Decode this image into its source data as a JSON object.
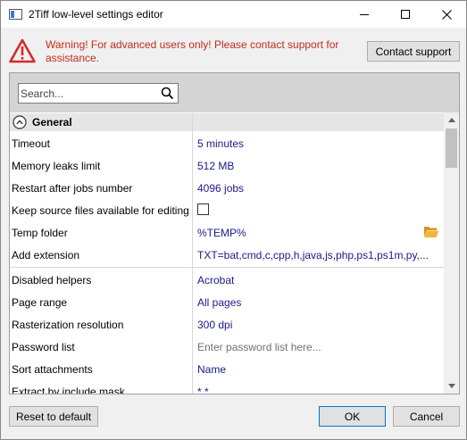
{
  "window": {
    "title": "2Tiff low-level settings editor"
  },
  "warning": {
    "text": "Warning! For advanced users only! Please contact support for assistance.",
    "color": "#c42b1c"
  },
  "buttons": {
    "contact_support": "Contact support",
    "reset_to_default": "Reset to default",
    "ok": "OK",
    "cancel": "Cancel"
  },
  "search": {
    "placeholder": "Search..."
  },
  "category": {
    "label": "General",
    "expanded": true
  },
  "rows": [
    {
      "name": "Timeout",
      "value": "5 minutes"
    },
    {
      "name": "Memory leaks limit",
      "value": "512 MB"
    },
    {
      "name": "Restart after jobs number",
      "value": "4096 jobs"
    },
    {
      "name": "Keep source files available for editing",
      "value": "",
      "checked": false
    },
    {
      "name": "Temp folder",
      "value": "%TEMP%"
    },
    {
      "name": "Add extension",
      "value": "TXT=bat,cmd,c,cpp,h,java,js,php,ps1,ps1m,py,..."
    },
    {
      "name": "Disabled helpers",
      "value": "Acrobat"
    },
    {
      "name": "Page range",
      "value": "All pages"
    },
    {
      "name": "Rasterization resolution",
      "value": "300 dpi"
    },
    {
      "name": "Password list",
      "value": "Enter password list here..."
    },
    {
      "name": "Sort attachments",
      "value": "Name"
    },
    {
      "name": "Extract by include mask",
      "value": "*.*"
    }
  ],
  "icons": {
    "warning": "warning-triangle-icon",
    "search": "search-icon",
    "collapse": "chevron-up-circle-icon",
    "folder": "folder-open-icon"
  },
  "colors": {
    "value_text": "#1a1a8c",
    "folder": "#e8a317",
    "accent": "#0078d7"
  }
}
